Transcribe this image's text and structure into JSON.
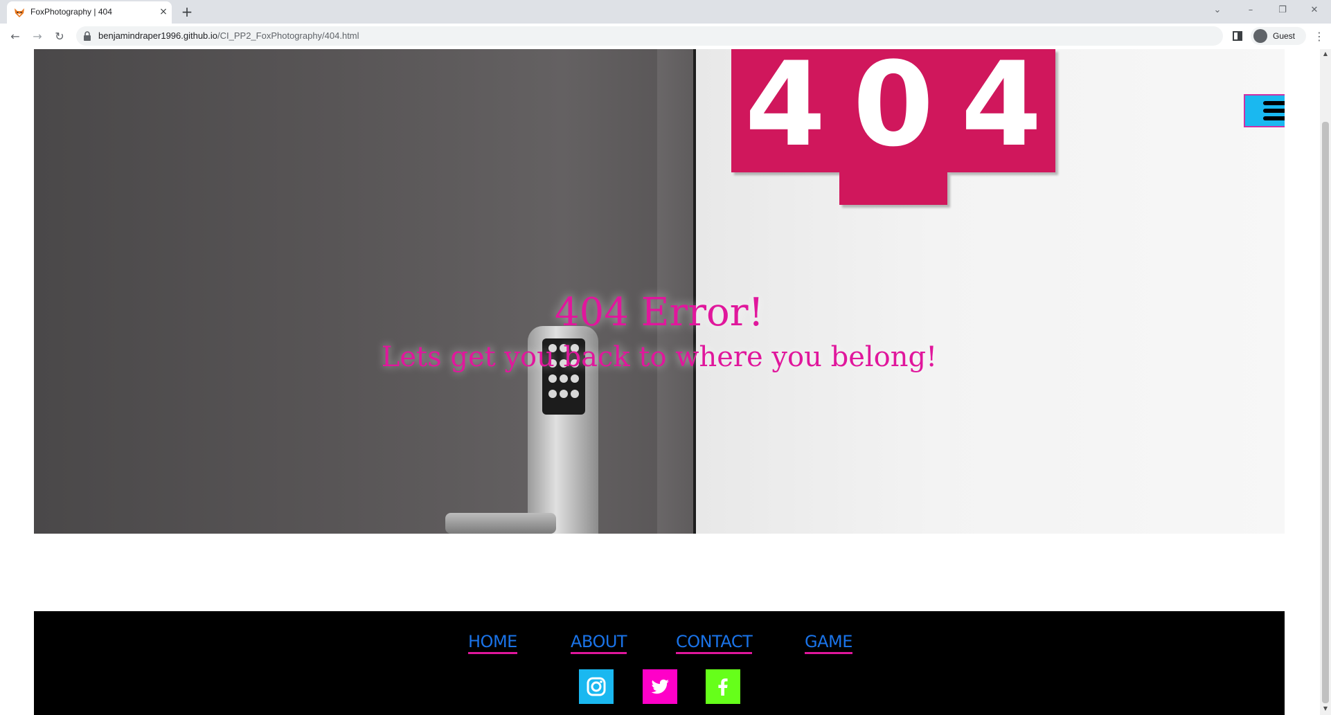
{
  "browser": {
    "tab_title": "FoxPhotography | 404",
    "close_glyph": "×",
    "new_tab_glyph": "+",
    "url_host": "benjamindraper1996.github.io",
    "url_path": "/CI_PP2_FoxPhotography/404.html",
    "profile_label": "Guest",
    "window_controls": {
      "minimize": "–",
      "restore": "❐",
      "close": "✕"
    },
    "nav_glyphs": {
      "back": "←",
      "forward": "→",
      "reload": "↻",
      "menu": "⋮",
      "tabs_dropdown": "⌄"
    }
  },
  "hero": {
    "plates": [
      "4",
      "0",
      "4"
    ],
    "title": "404 Error!",
    "subtitle": "Lets get you back to where you belong!"
  },
  "footer": {
    "links": [
      "HOME",
      "ABOUT",
      "CONTACT",
      "GAME"
    ]
  },
  "icons": {
    "menu": "hamburger-menu-icon",
    "instagram": "instagram-icon",
    "twitter": "twitter-icon",
    "facebook": "facebook-icon"
  },
  "colors": {
    "accent_pink": "#e0179c",
    "menu_button_bg": "#1ab8f0",
    "link_blue": "#1a73e8",
    "instagram_bg": "#1ab8f0",
    "twitter_bg": "#ff00c8",
    "facebook_bg": "#66ff1a",
    "footer_bg": "#000000",
    "plate_red": "#d0175c"
  }
}
